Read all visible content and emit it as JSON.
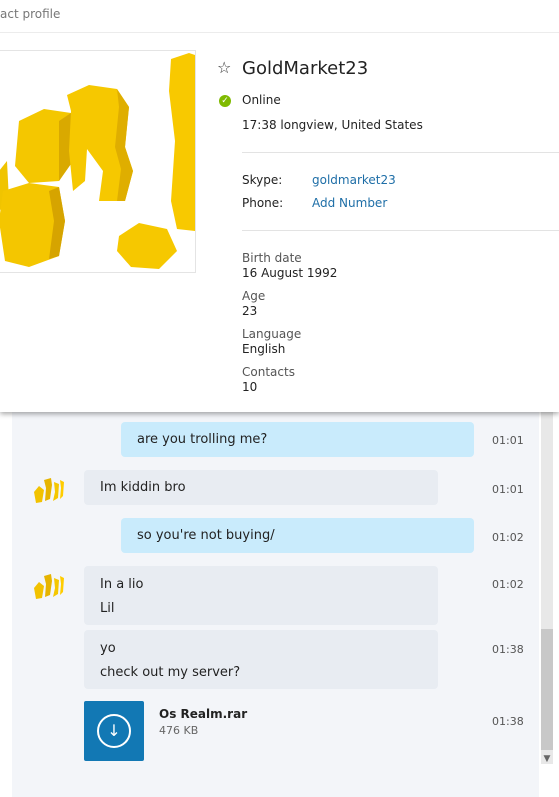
{
  "profile": {
    "title": "act profile",
    "name": "GoldMarket23",
    "status": "Online",
    "location": "17:38 longview, United States",
    "skype_label": "Skype:",
    "skype_value": "goldmarket23",
    "phone_label": "Phone:",
    "phone_value": "Add Number",
    "birth_label": "Birth date",
    "birth_value": "16 August 1992",
    "age_label": "Age",
    "age_value": "23",
    "language_label": "Language",
    "language_value": "English",
    "contacts_label": "Contacts",
    "contacts_value": "10"
  },
  "messages": [
    {
      "direction": "out",
      "lines": [
        "are you trolling me?"
      ],
      "time": "01:01"
    },
    {
      "direction": "in",
      "lines": [
        "Im kiddin bro"
      ],
      "time": "01:01"
    },
    {
      "direction": "out",
      "lines": [
        "so you're not buying/"
      ],
      "time": "01:02"
    },
    {
      "direction": "in",
      "lines": [
        "In a lio",
        "Lil"
      ],
      "time": "01:02"
    },
    {
      "direction": "in",
      "lines": [
        "yo",
        "check out my server?"
      ],
      "time": "01:38"
    }
  ],
  "file": {
    "name": "Os Realm.rar",
    "size": "476 KB",
    "time": "01:38",
    "icon": "download-icon"
  },
  "colors": {
    "accent": "#00aff0",
    "link": "#1e6ea7",
    "online": "#7fba00",
    "outgoing": "#c9ebfc",
    "incoming": "#e8ecf2",
    "file_tile": "#1278b4"
  }
}
